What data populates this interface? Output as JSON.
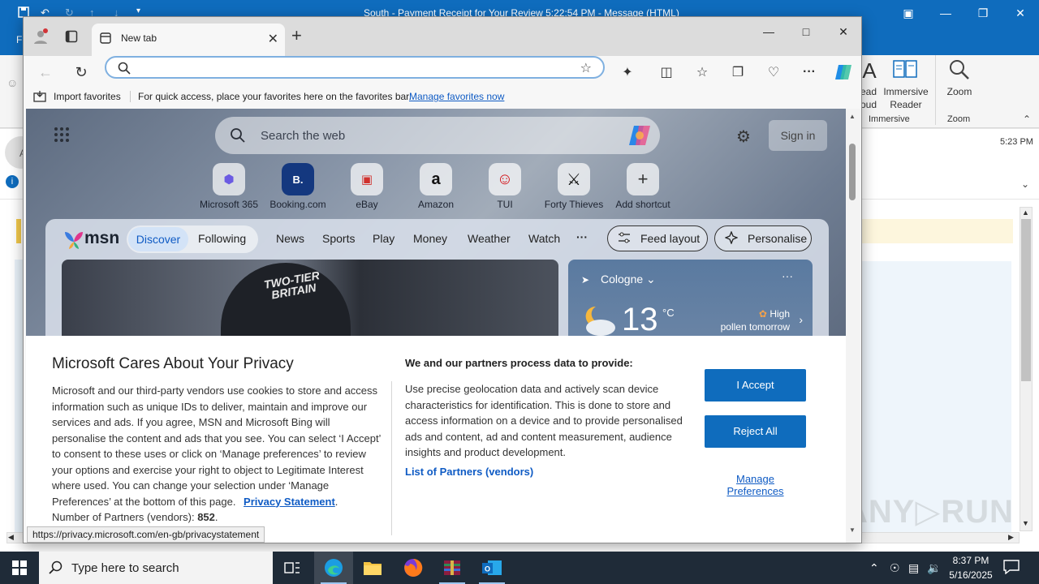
{
  "outlook": {
    "title": "South - Payment Receipt for Your Review 5:22:54 PM  -  Message (HTML)",
    "file_tab": "F",
    "ribbon": {
      "read_aloud_1": "ead",
      "read_aloud_2": "oud",
      "immersive_reader_1": "Immersive",
      "immersive_reader_2": "Reader",
      "zoom": "Zoom",
      "group_immersive": "Immersive",
      "group_zoom": "Zoom"
    },
    "message_time": "5:23 PM",
    "left_avatar_initial": "A"
  },
  "edge": {
    "tab_title": "New tab",
    "address_value": "",
    "favorites_bar": {
      "import": "Import favorites",
      "hint": "For quick access, place your favorites here on the favorites bar.",
      "manage_link": "Manage favorites now"
    },
    "ntp": {
      "search_placeholder": "Search the web",
      "sign_in": "Sign in",
      "shortcuts": [
        {
          "label": "Microsoft 365",
          "glyph": "⬢"
        },
        {
          "label": "Booking.com",
          "glyph": "B."
        },
        {
          "label": "eBay",
          "glyph": "▣"
        },
        {
          "label": "Amazon",
          "glyph": "a"
        },
        {
          "label": "TUI",
          "glyph": "☺"
        },
        {
          "label": "Forty Thieves",
          "glyph": "⚔"
        },
        {
          "label": "Add shortcut",
          "glyph": "+"
        }
      ]
    },
    "msn": {
      "logo": "msn",
      "tabs": {
        "discover": "Discover",
        "following": "Following"
      },
      "nav": [
        "News",
        "Sports",
        "Play",
        "Money",
        "Weather",
        "Watch",
        "···"
      ],
      "feed_layout": "Feed layout",
      "personalise": "Personalise",
      "hero_text_1": "TWO-TIER",
      "hero_text_2": "BRITAIN",
      "weather": {
        "location": "Cologne",
        "temperature": "13",
        "unit": "°C",
        "pollen_1": "High",
        "pollen_2": "pollen tomorrow",
        "more": "···"
      }
    },
    "privacy": {
      "title": "Microsoft Cares About Your Privacy",
      "body": "Microsoft and our third-party vendors use cookies to store and access information such as unique IDs to deliver, maintain and improve our services and ads. If you agree, MSN and Microsoft Bing will personalise the content and ads that you see. You can select ‘I Accept’ to consent to these uses or click on ‘Manage preferences’ to review your options and exercise your right to object to Legitimate Interest where used.  You can change your selection under ‘Manage Preferences’ at the bottom of this page. ",
      "privacy_statement": "Privacy Statement",
      "after_link": ".",
      "partners_count_label": "Number of Partners (vendors): ",
      "partners_count": "852",
      "partners_count_after": ".",
      "right_title": "We and our partners process data to provide:",
      "right_body": "Use precise geolocation data and actively scan device characteristics for identification. This is done to store and access information on a device and to provide personalised ads and content, ad and content measurement, audience insights and product development.",
      "partners_link": "List of Partners (vendors)",
      "accept": "I Accept",
      "reject": "Reject All",
      "manage_1": "Manage",
      "manage_2": "Preferences"
    },
    "status_url": "https://privacy.microsoft.com/en-gb/privacystatement"
  },
  "taskbar": {
    "search_placeholder": "Type here to search",
    "time": "8:37 PM",
    "date": "5/16/2025"
  },
  "watermark": "ANY▷RUN",
  "colors": {
    "outlook_blue": "#0f6cbd",
    "link_blue": "#0f5bc4",
    "button_blue": "#0f6cbd",
    "taskbar": "#1f2b38"
  }
}
